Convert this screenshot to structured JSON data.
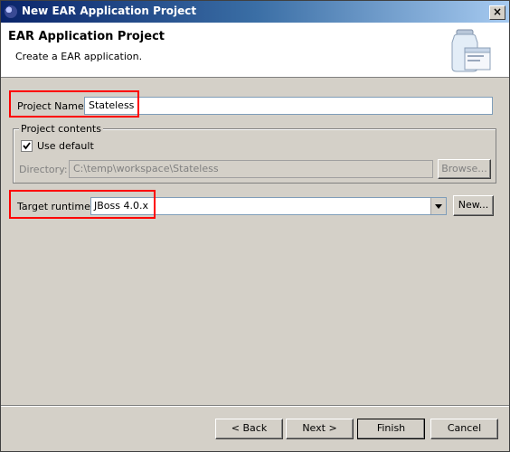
{
  "window": {
    "title": "New EAR Application Project",
    "close_glyph": "×"
  },
  "header": {
    "title": "EAR Application Project",
    "description": "Create a EAR application.",
    "banner_icon": "jar-wizard-icon"
  },
  "project_name": {
    "label": "Project Name:",
    "value": "Stateless"
  },
  "project_contents": {
    "legend": "Project contents",
    "use_default_label": "Use default",
    "use_default_checked": true,
    "directory_label": "Directory:",
    "directory_value": "C:\\temp\\workspace\\Stateless",
    "browse_label": "Browse..."
  },
  "target_runtime": {
    "label": "Target runtime:",
    "value": "JBoss 4.0.x",
    "new_label": "New..."
  },
  "buttons": {
    "back": "< Back",
    "next": "Next >",
    "finish": "Finish",
    "cancel": "Cancel"
  },
  "colors": {
    "title_start": "#0a246a",
    "title_end": "#a6caf0",
    "highlight": "#ff0000"
  }
}
